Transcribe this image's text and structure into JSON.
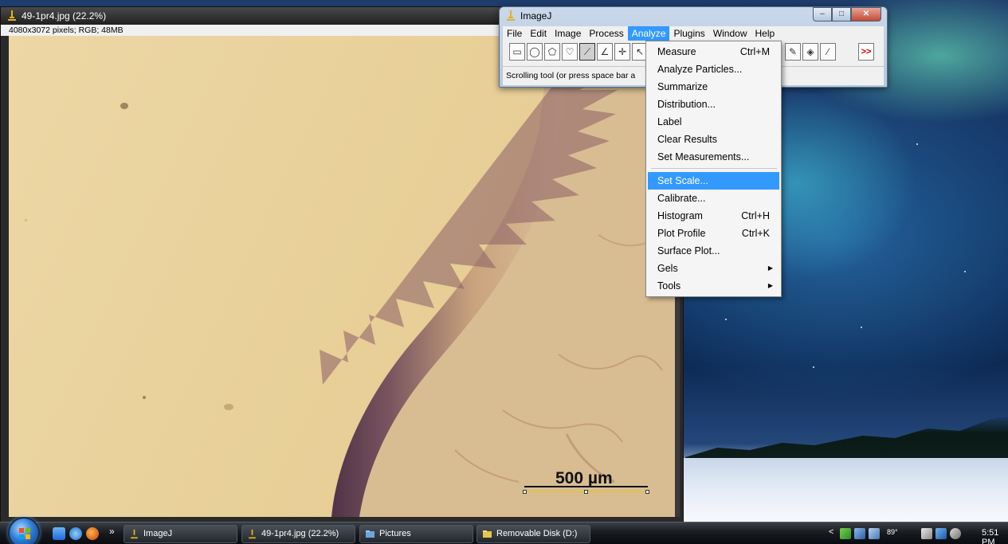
{
  "image_window": {
    "title": "49-1pr4.jpg (22.2%)",
    "info": "4080x3072 pixels; RGB; 48MB",
    "scale_bar_label": "500 µm"
  },
  "imagej_window": {
    "title": "ImageJ",
    "menus": [
      "File",
      "Edit",
      "Image",
      "Process",
      "Analyze",
      "Plugins",
      "Window",
      "Help"
    ],
    "active_menu": "Analyze",
    "status": "Scrolling tool (or press space bar a",
    "more_tools": ">>"
  },
  "analyze_menu": {
    "items": [
      {
        "label": "Measure",
        "shortcut": "Ctrl+M"
      },
      {
        "label": "Analyze Particles...",
        "shortcut": ""
      },
      {
        "label": "Summarize",
        "shortcut": ""
      },
      {
        "label": "Distribution...",
        "shortcut": ""
      },
      {
        "label": "Label",
        "shortcut": ""
      },
      {
        "label": "Clear Results",
        "shortcut": ""
      },
      {
        "label": "Set Measurements...",
        "shortcut": ""
      },
      {
        "label": "Set Scale...",
        "shortcut": "",
        "highlighted": true
      },
      {
        "label": "Calibrate...",
        "shortcut": ""
      },
      {
        "label": "Histogram",
        "shortcut": "Ctrl+H"
      },
      {
        "label": "Plot Profile",
        "shortcut": "Ctrl+K"
      },
      {
        "label": "Surface Plot...",
        "shortcut": ""
      },
      {
        "label": "Gels",
        "shortcut": "",
        "submenu": true
      },
      {
        "label": "Tools",
        "shortcut": "",
        "submenu": true
      }
    ]
  },
  "taskbar": {
    "quicklaunch_chevron": "»",
    "buttons": [
      {
        "label": "ImageJ",
        "icon": "imagej-icon"
      },
      {
        "label": "49-1pr4.jpg (22.2%)",
        "icon": "imagej-icon"
      },
      {
        "label": "Pictures",
        "icon": "folder-icon"
      },
      {
        "label": "Removable Disk (D:)",
        "icon": "folder-icon"
      }
    ],
    "tray": {
      "chevron": "<",
      "temperature": "89°",
      "clock": "5:51 PM"
    }
  },
  "colors": {
    "menu_highlight": "#3399ff",
    "tissue_dark": "#5a3a4a",
    "tissue_light": "#d8b88a",
    "background_slide": "#e8cf98"
  }
}
